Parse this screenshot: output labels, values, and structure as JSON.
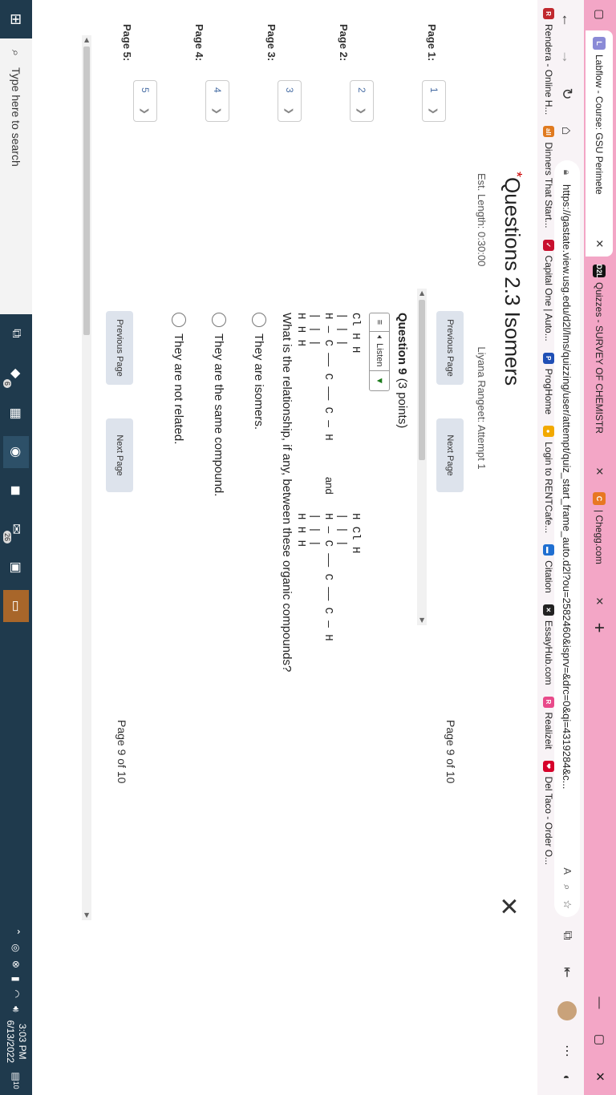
{
  "browser": {
    "tabs": [
      {
        "title": "Labflow - Course: GSU Perimete",
        "icon": "labflow-icon",
        "active": true
      },
      {
        "title": "Quizzes - SURVEY OF CHEMISTR",
        "icon": "d2l-icon",
        "active": false
      },
      {
        "title": "| Chegg.com",
        "icon": "chegg-icon",
        "active": false
      }
    ],
    "url": "https://gastate.view.usg.edu/d2l/lms/quizzing/user/attempt/quiz_start_frame_auto.d2l?ou=2582460&isprv=&drc=0&qi=4319284&c...",
    "bookmarks": [
      {
        "label": "Rendera - Online H...",
        "color": "#c0282e",
        "glyph": "R"
      },
      {
        "label": "Dinners That Start...",
        "color": "#e07a1f",
        "glyph": "all"
      },
      {
        "label": "Capital One | Auto...",
        "color": "#c8102e",
        "glyph": "✓"
      },
      {
        "label": "ProgHome",
        "color": "#1f4fb5",
        "glyph": "P"
      },
      {
        "label": "Login to RENTCafe...",
        "color": "#f2a900",
        "glyph": "●"
      },
      {
        "label": "Citation",
        "color": "#1f6fd1",
        "glyph": "▬"
      },
      {
        "label": "EssayHub.com",
        "color": "#222222",
        "glyph": "✕"
      },
      {
        "label": "Realizeit",
        "color": "#e84a8a",
        "glyph": "R"
      },
      {
        "label": "Del Taco - Order O...",
        "color": "#d6002a",
        "glyph": "❤"
      }
    ]
  },
  "quiz": {
    "title_prefix": "*",
    "title": "Questions 2.3 Isomers",
    "est_length": "Est. Length: 0:30:00",
    "attempt": "Liyana Rangeet: Attempt 1",
    "pages": [
      {
        "label": "Page 1:",
        "button": "1"
      },
      {
        "label": "Page 2:",
        "button": "2"
      },
      {
        "label": "Page 3:",
        "button": "3"
      },
      {
        "label": "Page 4:",
        "button": "4"
      },
      {
        "label": "Page 5:",
        "button": "5"
      }
    ],
    "previous_label": "Previous Page",
    "next_label": "Next Page",
    "page_of": "Page 9 of 10",
    "question_number": "Question 9",
    "points": "(3 points)",
    "listen_label": "Listen",
    "and_label": "and",
    "question_text": "What is the relationship, if any, between these organic compounds?",
    "options": [
      "They are isomers.",
      "They are the same compound.",
      "They are not related."
    ],
    "molecule1": [
      "    Cl   H    H",
      "    |    |    |",
      "H — C —— C —— C — H",
      "    |    |    |",
      "    H    H    H"
    ],
    "molecule2": [
      "    H    Cl   H",
      "    |    |    |",
      "H — C —— C —— C — H",
      "    |    |    |",
      "    H    H    H"
    ]
  },
  "taskbar": {
    "search_placeholder": "Type here to search",
    "time": "3:03 PM",
    "date": "6/13/2022",
    "badge_edge": "6",
    "badge_mail": "26",
    "notif_count": "10"
  }
}
